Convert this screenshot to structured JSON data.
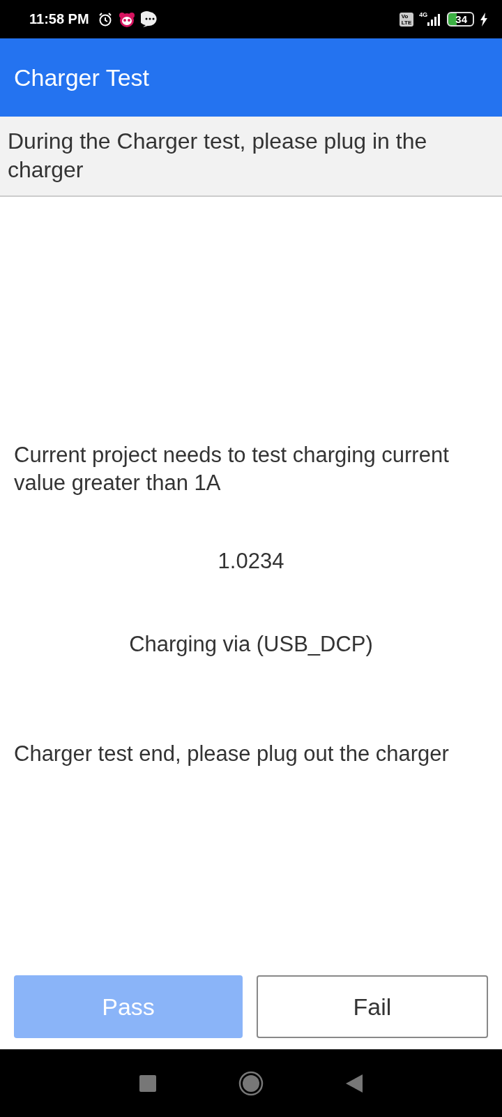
{
  "status_bar": {
    "time": "11:58 PM",
    "network": "4G",
    "battery": "34",
    "volte_top": "Vo",
    "volte_bottom": "LTE"
  },
  "app_bar": {
    "title": "Charger Test"
  },
  "instruction": "During the Charger test, please plug in the charger",
  "requirement": "Current project needs to test charging current value greater than 1A",
  "current_value": "1.0234",
  "charging_source": "Charging via (USB_DCP)",
  "end_message": "Charger test end, please plug out the charger",
  "buttons": [
    {
      "label": "Pass",
      "kind": "primary",
      "disabled": true
    },
    {
      "label": "Fail",
      "kind": "outline",
      "disabled": false
    }
  ]
}
